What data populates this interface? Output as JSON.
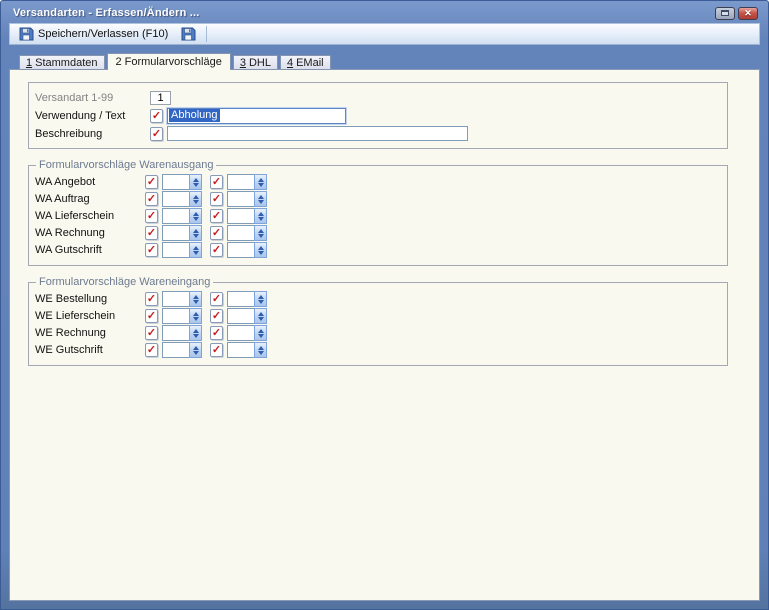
{
  "window": {
    "title": "Versandarten - Erfassen/Ändern ..."
  },
  "icons": {
    "check": "✓",
    "close": "✕"
  },
  "toolbar": {
    "save_button_label": "Speichern/Verlassen (F10)"
  },
  "tabs": [
    {
      "number": "1",
      "label": "Stammdaten",
      "active": false
    },
    {
      "number": "2",
      "label": "Formularvorschläge",
      "active": true
    },
    {
      "number": "3",
      "label": "DHL",
      "active": false
    },
    {
      "number": "4",
      "label": "EMail",
      "active": false
    }
  ],
  "form": {
    "versandart": {
      "label": "Versandart 1-99",
      "value": "1"
    },
    "verwendung": {
      "label": "Verwendung / Text",
      "value": "Abholung"
    },
    "beschreibung": {
      "label": "Beschreibung",
      "value": ""
    }
  },
  "groups": [
    {
      "legend": "Formularvorschläge Warenausgang",
      "rows": [
        {
          "label": "WA Angebot"
        },
        {
          "label": "WA Auftrag"
        },
        {
          "label": "WA Lieferschein"
        },
        {
          "label": "WA Rechnung"
        },
        {
          "label": "WA Gutschrift"
        }
      ]
    },
    {
      "legend": "Formularvorschläge Wareneingang",
      "rows": [
        {
          "label": "WE Bestellung"
        },
        {
          "label": "WE Lieferschein"
        },
        {
          "label": "WE Rechnung"
        },
        {
          "label": "WE Gutschrift"
        }
      ]
    }
  ],
  "colors": {
    "frame_blue": "#6081B7",
    "titlebar_text": "#FFFFFF",
    "panel_cream": "#FAF9F0",
    "selection_blue": "#3166C5",
    "close_red": "#B8453C",
    "check_red": "#C81E1E",
    "spinner_blue": "#2F5BB0"
  }
}
